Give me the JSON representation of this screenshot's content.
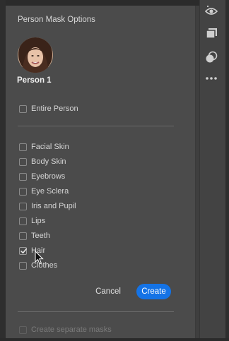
{
  "dialog": {
    "title": "Person Mask Options",
    "person_name": "Person 1"
  },
  "options": {
    "entire_person": {
      "label": "Entire Person",
      "checked": false
    },
    "parts": [
      {
        "label": "Facial Skin",
        "checked": false
      },
      {
        "label": "Body Skin",
        "checked": false
      },
      {
        "label": "Eyebrows",
        "checked": false
      },
      {
        "label": "Eye Sclera",
        "checked": false
      },
      {
        "label": "Iris and Pupil",
        "checked": false
      },
      {
        "label": "Lips",
        "checked": false
      },
      {
        "label": "Teeth",
        "checked": false
      },
      {
        "label": "Hair",
        "checked": true
      },
      {
        "label": "Clothes",
        "checked": false
      }
    ],
    "separate_masks": {
      "label": "Create separate masks",
      "checked": false,
      "disabled": true
    }
  },
  "buttons": {
    "cancel": "Cancel",
    "create": "Create"
  },
  "rail": {
    "icons": [
      "eye-icon",
      "layers-icon",
      "circles-icon",
      "more-icon"
    ]
  },
  "colors": {
    "accent": "#1473e6",
    "panel": "#4b4b4b"
  }
}
